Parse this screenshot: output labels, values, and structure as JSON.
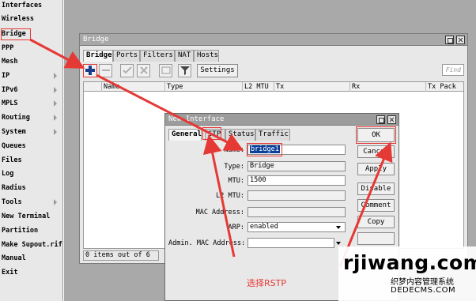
{
  "menu": {
    "items": [
      {
        "label": "Interfaces",
        "arrow": false
      },
      {
        "label": "Wireless",
        "arrow": false
      },
      {
        "label": "Bridge",
        "arrow": false
      },
      {
        "label": "PPP",
        "arrow": false
      },
      {
        "label": "Mesh",
        "arrow": false
      },
      {
        "label": "IP",
        "arrow": true
      },
      {
        "label": "IPv6",
        "arrow": true
      },
      {
        "label": "MPLS",
        "arrow": true
      },
      {
        "label": "Routing",
        "arrow": true
      },
      {
        "label": "System",
        "arrow": true
      },
      {
        "label": "Queues",
        "arrow": false
      },
      {
        "label": "Files",
        "arrow": false
      },
      {
        "label": "Log",
        "arrow": false
      },
      {
        "label": "Radius",
        "arrow": false
      },
      {
        "label": "Tools",
        "arrow": true
      },
      {
        "label": "New Terminal",
        "arrow": false
      },
      {
        "label": "Partition",
        "arrow": false
      },
      {
        "label": "Make Supout.rif",
        "arrow": false
      },
      {
        "label": "Manual",
        "arrow": false
      },
      {
        "label": "Exit",
        "arrow": false
      }
    ]
  },
  "bridge_window": {
    "title": "Bridge",
    "tabs": [
      "Bridge",
      "Ports",
      "Filters",
      "NAT",
      "Hosts"
    ],
    "settings_label": "Settings",
    "find_placeholder": "Find",
    "columns": [
      "Name",
      "Type",
      "L2 MTU",
      "Tx",
      "Rx",
      "Tx Pack"
    ],
    "status": "0 items out of 6"
  },
  "new_interface": {
    "title": "New Interface",
    "tabs": [
      "General",
      "STP",
      "Status",
      "Traffic"
    ],
    "fields": {
      "name_label": "Name:",
      "name_value": "bridge1",
      "type_label": "Type:",
      "type_value": "Bridge",
      "mtu_label": "MTU:",
      "mtu_value": "1500",
      "l2mtu_label": "L2 MTU:",
      "l2mtu_value": "",
      "mac_label": "MAC Address:",
      "mac_value": "",
      "arp_label": "ARP:",
      "arp_value": "enabled",
      "admin_mac_label": "Admin. MAC Address:",
      "admin_mac_value": ""
    },
    "buttons": [
      "OK",
      "Cancel",
      "Apply",
      "Disable",
      "Comment",
      "Copy"
    ]
  },
  "annotation": {
    "caption": "选择RSTP",
    "color": "#e53935"
  },
  "watermark": {
    "main": "rjiwang.com",
    "sub1": "织梦内容管理系统",
    "sub2": "DEDECMS.COM"
  }
}
